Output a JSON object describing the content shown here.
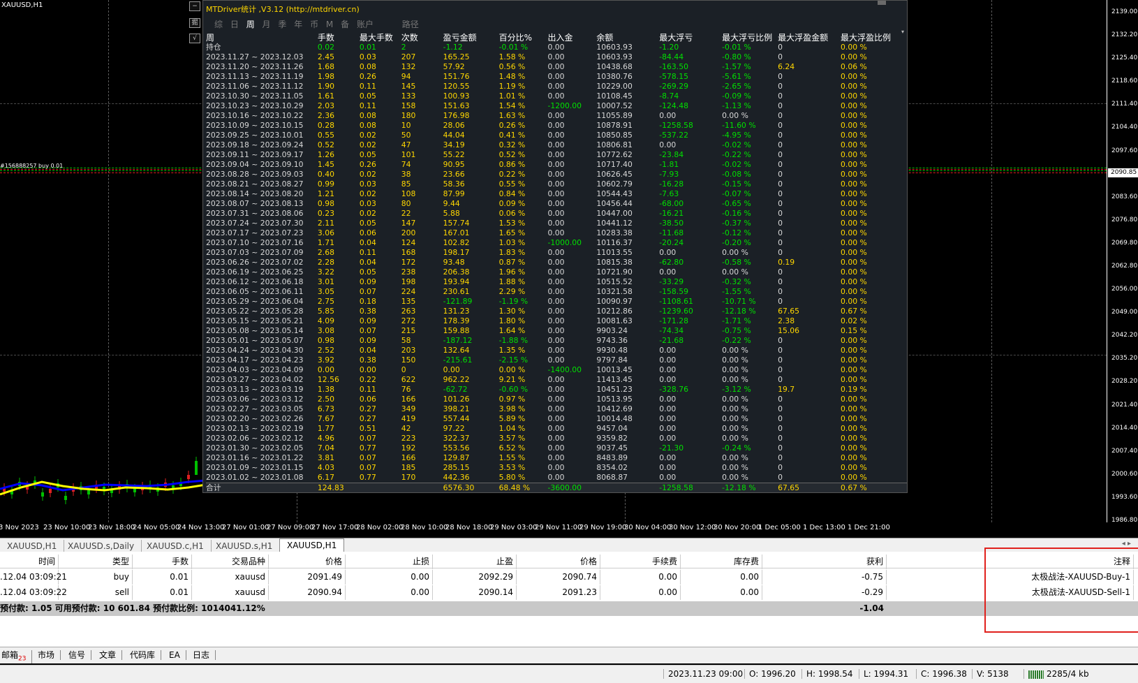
{
  "chart": {
    "symbol_title": "XAUUSD,H1",
    "order_line_label": "#156888257 buy 0.01",
    "current_price": "2090.85",
    "y_labels": [
      "2139.00",
      "2132.20",
      "2125.40",
      "2118.60",
      "2111.40",
      "2104.40",
      "2097.60",
      "2090.85",
      "2083.60",
      "2076.80",
      "2069.80",
      "2062.80",
      "2056.00",
      "2049.00",
      "2042.20",
      "2035.20",
      "2028.20",
      "2021.40",
      "2014.40",
      "2007.40",
      "2000.60",
      "1993.60",
      "1986.80"
    ],
    "x_labels": [
      "3 Nov 2023",
      "23 Nov 10:00",
      "23 Nov 18:00",
      "24 Nov 05:00",
      "24 Nov 13:00",
      "27 Nov 01:00",
      "27 Nov 09:00",
      "27 Nov 17:00",
      "28 Nov 02:00",
      "28 Nov 10:00",
      "28 Nov 18:00",
      "29 Nov 03:00",
      "29 Nov 11:00",
      "29 Nov 19:00",
      "30 Nov 04:00",
      "30 Nov 12:00",
      "30 Nov 20:00",
      "1 Dec 05:00",
      "1 Dec 13:00",
      "1 Dec 21:00"
    ],
    "side_buttons": [
      "−",
      "掘",
      "√"
    ]
  },
  "panel": {
    "title": "MTDriver统计 ,V3.12 (http://mtdriver.cn)",
    "tabs": [
      "综",
      "日",
      "周",
      "月",
      "季",
      "年",
      "币",
      "M",
      "备",
      "账户",
      "路径"
    ],
    "headers": [
      "周",
      "手数",
      "最大手数",
      "次数",
      "盈亏金额",
      "百分比%",
      "出入金",
      "余额",
      "最大浮亏",
      "最大浮亏比例",
      "最大浮盈金额",
      "最大浮盈比例"
    ],
    "rows": [
      [
        "持仓",
        "0.02",
        "0.01",
        "2",
        "-1.12",
        "-0.01 %",
        "0.00",
        "10603.93",
        "-1.20",
        "-0.01 %",
        "0",
        "0.00 %"
      ],
      [
        "2023.11.27 ~ 2023.12.03",
        "2.45",
        "0.03",
        "207",
        "165.25",
        "1.58 %",
        "0.00",
        "10603.93",
        "-84.44",
        "-0.80 %",
        "0",
        "0.00 %"
      ],
      [
        "2023.11.20 ~ 2023.11.26",
        "1.68",
        "0.08",
        "132",
        "57.92",
        "0.56 %",
        "0.00",
        "10438.68",
        "-163.50",
        "-1.57 %",
        "6.24",
        "0.06 %"
      ],
      [
        "2023.11.13 ~ 2023.11.19",
        "1.98",
        "0.26",
        "94",
        "151.76",
        "1.48 %",
        "0.00",
        "10380.76",
        "-578.15",
        "-5.61 %",
        "0",
        "0.00 %"
      ],
      [
        "2023.11.06 ~ 2023.11.12",
        "1.90",
        "0.11",
        "145",
        "120.55",
        "1.19 %",
        "0.00",
        "10229.00",
        "-269.29",
        "-2.65 %",
        "0",
        "0.00 %"
      ],
      [
        "2023.10.30 ~ 2023.11.05",
        "1.61",
        "0.05",
        "133",
        "100.93",
        "1.01 %",
        "0.00",
        "10108.45",
        "-8.74",
        "-0.09 %",
        "0",
        "0.00 %"
      ],
      [
        "2023.10.23 ~ 2023.10.29",
        "2.03",
        "0.11",
        "158",
        "151.63",
        "1.54 %",
        "-1200.00",
        "10007.52",
        "-124.48",
        "-1.13 %",
        "0",
        "0.00 %"
      ],
      [
        "2023.10.16 ~ 2023.10.22",
        "2.36",
        "0.08",
        "180",
        "176.98",
        "1.63 %",
        "0.00",
        "11055.89",
        "0.00",
        "0.00 %",
        "0",
        "0.00 %"
      ],
      [
        "2023.10.09 ~ 2023.10.15",
        "0.28",
        "0.08",
        "10",
        "28.06",
        "0.26 %",
        "0.00",
        "10878.91",
        "-1258.58",
        "-11.60 %",
        "0",
        "0.00 %"
      ],
      [
        "2023.09.25 ~ 2023.10.01",
        "0.55",
        "0.02",
        "50",
        "44.04",
        "0.41 %",
        "0.00",
        "10850.85",
        "-537.22",
        "-4.95 %",
        "0",
        "0.00 %"
      ],
      [
        "2023.09.18 ~ 2023.09.24",
        "0.52",
        "0.02",
        "47",
        "34.19",
        "0.32 %",
        "0.00",
        "10806.81",
        "0.00",
        "-0.02 %",
        "0",
        "0.00 %"
      ],
      [
        "2023.09.11 ~ 2023.09.17",
        "1.26",
        "0.05",
        "101",
        "55.22",
        "0.52 %",
        "0.00",
        "10772.62",
        "-23.84",
        "-0.22 %",
        "0",
        "0.00 %"
      ],
      [
        "2023.09.04 ~ 2023.09.10",
        "1.45",
        "0.26",
        "74",
        "90.95",
        "0.86 %",
        "0.00",
        "10717.40",
        "-1.81",
        "-0.02 %",
        "0",
        "0.00 %"
      ],
      [
        "2023.08.28 ~ 2023.09.03",
        "0.40",
        "0.02",
        "38",
        "23.66",
        "0.22 %",
        "0.00",
        "10626.45",
        "-7.93",
        "-0.08 %",
        "0",
        "0.00 %"
      ],
      [
        "2023.08.21 ~ 2023.08.27",
        "0.99",
        "0.03",
        "85",
        "58.36",
        "0.55 %",
        "0.00",
        "10602.79",
        "-16.28",
        "-0.15 %",
        "0",
        "0.00 %"
      ],
      [
        "2023.08.14 ~ 2023.08.20",
        "1.21",
        "0.02",
        "108",
        "87.99",
        "0.84 %",
        "0.00",
        "10544.43",
        "-7.63",
        "-0.07 %",
        "0",
        "0.00 %"
      ],
      [
        "2023.08.07 ~ 2023.08.13",
        "0.98",
        "0.03",
        "80",
        "9.44",
        "0.09 %",
        "0.00",
        "10456.44",
        "-68.00",
        "-0.65 %",
        "0",
        "0.00 %"
      ],
      [
        "2023.07.31 ~ 2023.08.06",
        "0.23",
        "0.02",
        "22",
        "5.88",
        "0.06 %",
        "0.00",
        "10447.00",
        "-16.21",
        "-0.16 %",
        "0",
        "0.00 %"
      ],
      [
        "2023.07.24 ~ 2023.07.30",
        "2.11",
        "0.05",
        "147",
        "157.74",
        "1.53 %",
        "0.00",
        "10441.12",
        "-38.50",
        "-0.37 %",
        "0",
        "0.00 %"
      ],
      [
        "2023.07.17 ~ 2023.07.23",
        "3.06",
        "0.06",
        "200",
        "167.01",
        "1.65 %",
        "0.00",
        "10283.38",
        "-11.68",
        "-0.12 %",
        "0",
        "0.00 %"
      ],
      [
        "2023.07.10 ~ 2023.07.16",
        "1.71",
        "0.04",
        "124",
        "102.82",
        "1.03 %",
        "-1000.00",
        "10116.37",
        "-20.24",
        "-0.20 %",
        "0",
        "0.00 %"
      ],
      [
        "2023.07.03 ~ 2023.07.09",
        "2.68",
        "0.11",
        "168",
        "198.17",
        "1.83 %",
        "0.00",
        "11013.55",
        "0.00",
        "0.00 %",
        "0",
        "0.00 %"
      ],
      [
        "2023.06.26 ~ 2023.07.02",
        "2.28",
        "0.04",
        "172",
        "93.48",
        "0.87 %",
        "0.00",
        "10815.38",
        "-62.80",
        "-0.58 %",
        "0.19",
        "0.00 %"
      ],
      [
        "2023.06.19 ~ 2023.06.25",
        "3.22",
        "0.05",
        "238",
        "206.38",
        "1.96 %",
        "0.00",
        "10721.90",
        "0.00",
        "0.00 %",
        "0",
        "0.00 %"
      ],
      [
        "2023.06.12 ~ 2023.06.18",
        "3.01",
        "0.09",
        "198",
        "193.94",
        "1.88 %",
        "0.00",
        "10515.52",
        "-33.29",
        "-0.32 %",
        "0",
        "0.00 %"
      ],
      [
        "2023.06.05 ~ 2023.06.11",
        "3.05",
        "0.07",
        "224",
        "230.61",
        "2.29 %",
        "0.00",
        "10321.58",
        "-158.59",
        "-1.55 %",
        "0",
        "0.00 %"
      ],
      [
        "2023.05.29 ~ 2023.06.04",
        "2.75",
        "0.18",
        "135",
        "-121.89",
        "-1.19 %",
        "0.00",
        "10090.97",
        "-1108.61",
        "-10.71 %",
        "0",
        "0.00 %"
      ],
      [
        "2023.05.22 ~ 2023.05.28",
        "5.85",
        "0.38",
        "263",
        "131.23",
        "1.30 %",
        "0.00",
        "10212.86",
        "-1239.60",
        "-12.18 %",
        "67.65",
        "0.67 %"
      ],
      [
        "2023.05.15 ~ 2023.05.21",
        "4.09",
        "0.09",
        "272",
        "178.39",
        "1.80 %",
        "0.00",
        "10081.63",
        "-171.28",
        "-1.71 %",
        "2.38",
        "0.02 %"
      ],
      [
        "2023.05.08 ~ 2023.05.14",
        "3.08",
        "0.07",
        "215",
        "159.88",
        "1.64 %",
        "0.00",
        "9903.24",
        "-74.34",
        "-0.75 %",
        "15.06",
        "0.15 %"
      ],
      [
        "2023.05.01 ~ 2023.05.07",
        "0.98",
        "0.09",
        "58",
        "-187.12",
        "-1.88 %",
        "0.00",
        "9743.36",
        "-21.68",
        "-0.22 %",
        "0",
        "0.00 %"
      ],
      [
        "2023.04.24 ~ 2023.04.30",
        "2.52",
        "0.04",
        "203",
        "132.64",
        "1.35 %",
        "0.00",
        "9930.48",
        "0.00",
        "0.00 %",
        "0",
        "0.00 %"
      ],
      [
        "2023.04.17 ~ 2023.04.23",
        "3.92",
        "0.38",
        "150",
        "-215.61",
        "-2.15 %",
        "0.00",
        "9797.84",
        "0.00",
        "0.00 %",
        "0",
        "0.00 %"
      ],
      [
        "2023.04.03 ~ 2023.04.09",
        "0.00",
        "0.00",
        "0",
        "0.00",
        "0.00 %",
        "-1400.00",
        "10013.45",
        "0.00",
        "0.00 %",
        "0",
        "0.00 %"
      ],
      [
        "2023.03.27 ~ 2023.04.02",
        "12.56",
        "0.22",
        "622",
        "962.22",
        "9.21 %",
        "0.00",
        "11413.45",
        "0.00",
        "0.00 %",
        "0",
        "0.00 %"
      ],
      [
        "2023.03.13 ~ 2023.03.19",
        "1.38",
        "0.11",
        "76",
        "-62.72",
        "-0.60 %",
        "0.00",
        "10451.23",
        "-328.76",
        "-3.12 %",
        "19.7",
        "0.19 %"
      ],
      [
        "2023.03.06 ~ 2023.03.12",
        "2.50",
        "0.06",
        "166",
        "101.26",
        "0.97 %",
        "0.00",
        "10513.95",
        "0.00",
        "0.00 %",
        "0",
        "0.00 %"
      ],
      [
        "2023.02.27 ~ 2023.03.05",
        "6.73",
        "0.27",
        "349",
        "398.21",
        "3.98 %",
        "0.00",
        "10412.69",
        "0.00",
        "0.00 %",
        "0",
        "0.00 %"
      ],
      [
        "2023.02.20 ~ 2023.02.26",
        "7.67",
        "0.27",
        "419",
        "557.44",
        "5.89 %",
        "0.00",
        "10014.48",
        "0.00",
        "0.00 %",
        "0",
        "0.00 %"
      ],
      [
        "2023.02.13 ~ 2023.02.19",
        "1.77",
        "0.51",
        "42",
        "97.22",
        "1.04 %",
        "0.00",
        "9457.04",
        "0.00",
        "0.00 %",
        "0",
        "0.00 %"
      ],
      [
        "2023.02.06 ~ 2023.02.12",
        "4.96",
        "0.07",
        "223",
        "322.37",
        "3.57 %",
        "0.00",
        "9359.82",
        "0.00",
        "0.00 %",
        "0",
        "0.00 %"
      ],
      [
        "2023.01.30 ~ 2023.02.05",
        "7.04",
        "0.77",
        "192",
        "553.56",
        "6.52 %",
        "0.00",
        "9037.45",
        "-21.30",
        "-0.24 %",
        "0",
        "0.00 %"
      ],
      [
        "2023.01.16 ~ 2023.01.22",
        "3.81",
        "0.07",
        "166",
        "129.87",
        "1.55 %",
        "0.00",
        "8483.89",
        "0.00",
        "0.00 %",
        "0",
        "0.00 %"
      ],
      [
        "2023.01.09 ~ 2023.01.15",
        "4.03",
        "0.07",
        "185",
        "285.15",
        "3.53 %",
        "0.00",
        "8354.02",
        "0.00",
        "0.00 %",
        "0",
        "0.00 %"
      ],
      [
        "2023.01.02 ~ 2023.01.08",
        "6.17",
        "0.77",
        "170",
        "442.36",
        "5.80 %",
        "0.00",
        "8068.87",
        "0.00",
        "0.00 %",
        "0",
        "0.00 %"
      ]
    ],
    "total": [
      "合计",
      "124.83",
      "",
      "",
      "6576.30",
      "68.48 %",
      "-3600.00",
      "",
      "-1258.58",
      "-12.18 %",
      "67.65",
      "0.67 %"
    ],
    "colors": {
      "white": "#d8d8d8",
      "yellow": "#ffd700",
      "green": "#00e000",
      "title": "#ffd700",
      "background": "#1b2026"
    }
  },
  "symbol_tabs": [
    "XAUUSD,H1",
    "XAUUSD.s,Daily",
    "XAUUSD.c,H1",
    "XAUUSD.s,H1",
    "XAUUSD,H1"
  ],
  "trade": {
    "headers": [
      "时间",
      "类型",
      "手数",
      "交易品种",
      "价格",
      "止损",
      "止盈",
      "价格",
      "手续费",
      "库存费",
      "获利",
      "注释"
    ],
    "rows": [
      [
        ".12.04 03:09:21",
        "buy",
        "0.01",
        "xauusd",
        "2091.49",
        "0.00",
        "2092.29",
        "2090.74",
        "0.00",
        "0.00",
        "-0.75",
        "太极战法-XAUUSD-Buy-1"
      ],
      [
        ".12.04 03:09:22",
        "sell",
        "0.01",
        "xauusd",
        "2090.94",
        "0.00",
        "2090.14",
        "2091.23",
        "0.00",
        "0.00",
        "-0.29",
        "太极战法-XAUUSD-Sell-1"
      ]
    ],
    "summary": "预付款: 1.05  可用预付款: 10 601.84  预付款比例: 1014041.12%",
    "summary_profit": "-1.04"
  },
  "bottom_tabs": [
    "邮箱",
    "市场",
    "信号",
    "文章",
    "代码库",
    "EA",
    "日志"
  ],
  "mail_badge": "23",
  "status": {
    "datetime": "2023.11.23 09:00",
    "open": "O: 1996.20",
    "high": "H: 1998.54",
    "low": "L: 1994.31",
    "close": "C: 1996.38",
    "volume": "V: 5138",
    "connection": "2285/4 kb"
  }
}
